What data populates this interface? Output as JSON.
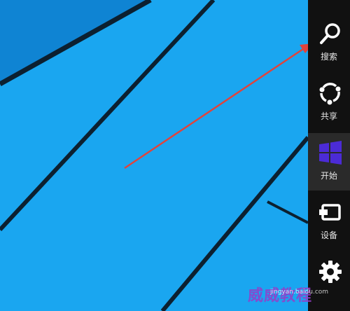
{
  "charms": [
    {
      "label": "搜索",
      "icon": "search-icon"
    },
    {
      "label": "共享",
      "icon": "share-icon"
    },
    {
      "label": "开始",
      "icon": "windows-logo-icon"
    },
    {
      "label": "设备",
      "icon": "devices-icon"
    },
    {
      "label": "",
      "icon": "settings-icon"
    }
  ],
  "watermark": {
    "text": "威威教程",
    "sub_text": "jingyan.baidu.com"
  },
  "colors": {
    "desktop": "#1aa6f0",
    "charm_bar": "#111111",
    "windows_logo": "#4b2bd6",
    "arrow": "#e0443c"
  }
}
